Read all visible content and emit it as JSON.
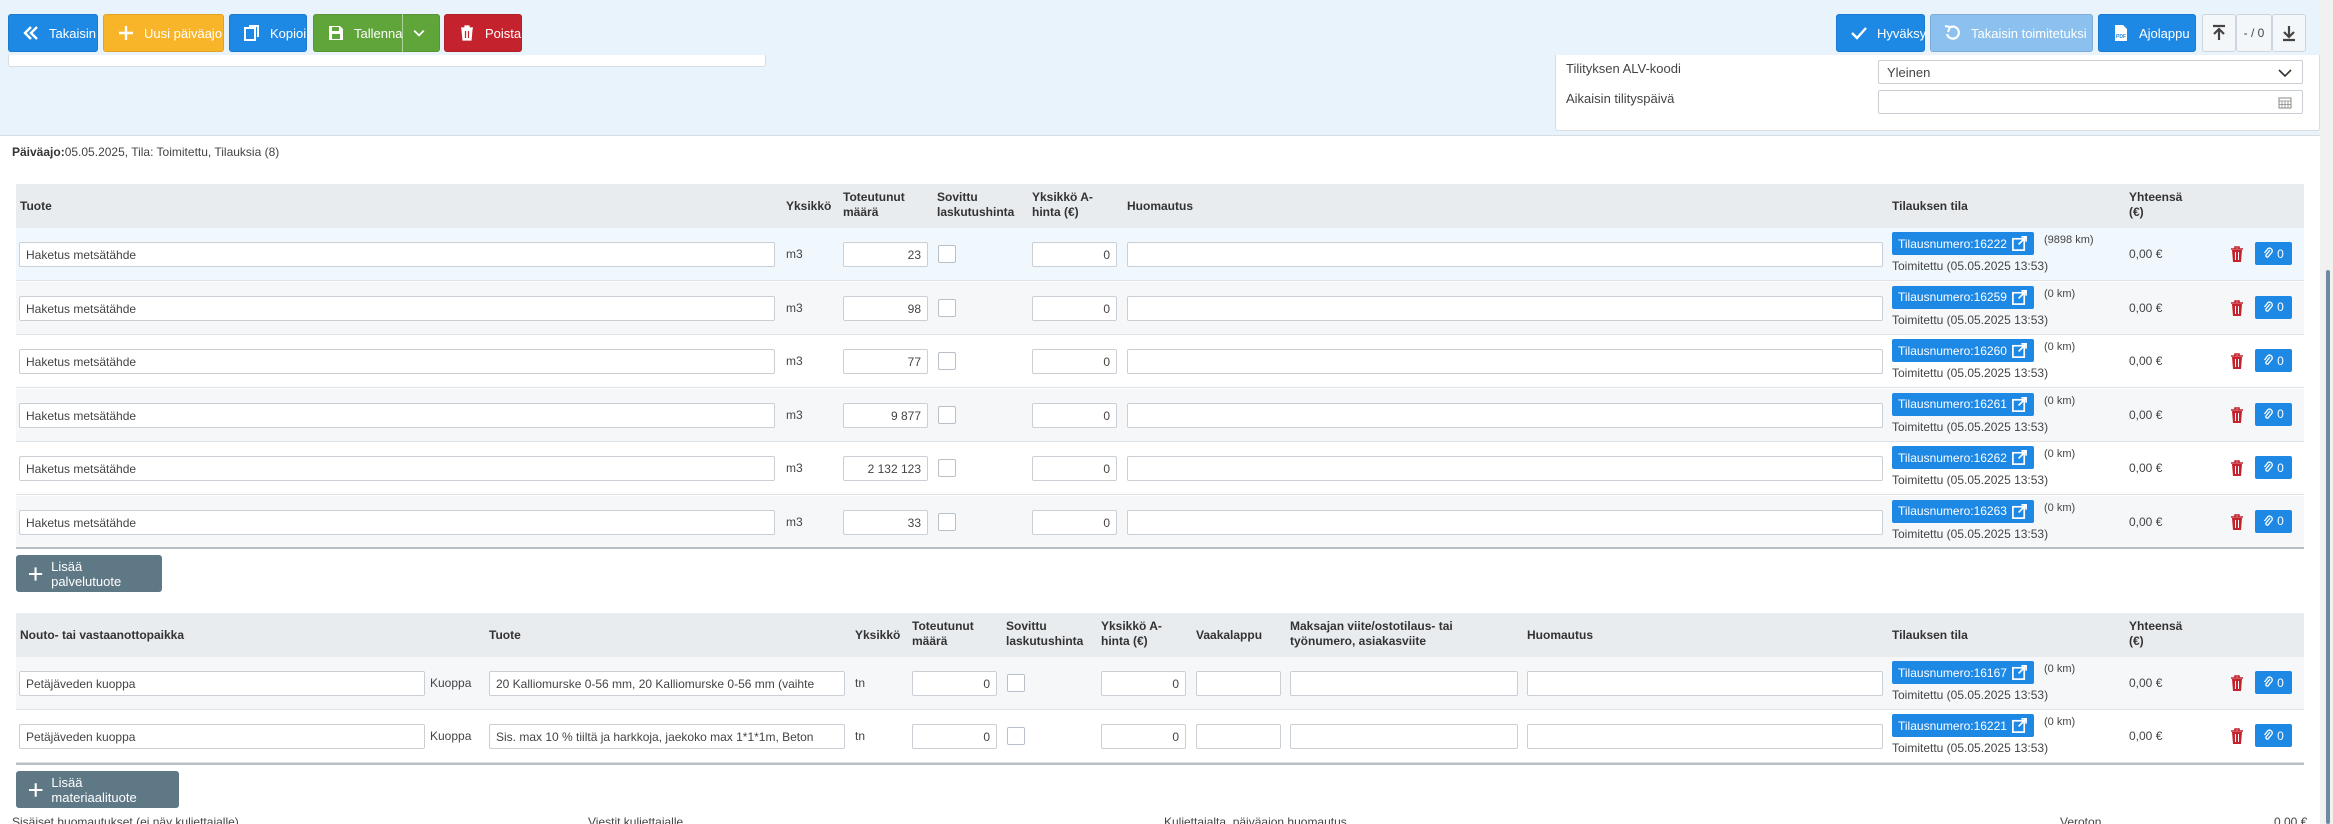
{
  "toolbar": {
    "back": "Takaisin",
    "new_day": "Uusi päiväajo",
    "copy": "Kopioi",
    "save": "Tallenna",
    "delete": "Poista",
    "approve": "Hyväksy",
    "revert": "Takaisin toimitetuksi",
    "trip_pdf": "Ajolappu",
    "counter": "- / 0"
  },
  "settlement": {
    "vat_label": "Tilityksen ALV-koodi",
    "vat_value": "Yleinen",
    "earliest_label": "Aikaisin tilityspäivä",
    "earliest_value": ""
  },
  "day": {
    "title_bold": "Päiväajo:",
    "title_rest": "05.05.2025, Tila: Toimitettu, Tilauksia (8)"
  },
  "services": {
    "headers": {
      "product": "Tuote",
      "unit": "Yksikkö",
      "actual_qty": "Toteutunut määrä",
      "agreed_price": "Sovittu laskutushinta",
      "unit_price": "Yksikkö A-hinta (€)",
      "note": "Huomautus",
      "order_status": "Tilauksen tila",
      "total": "Yhteensä (€)"
    },
    "rows": [
      {
        "product": "Haketus metsätähde",
        "unit": "m3",
        "qty": "23",
        "price": "0",
        "order": "Tilausnumero:16222",
        "distance": "(9898 km)",
        "status": "Toimitettu (05.05.2025 13:53)",
        "total": "0,00 €",
        "attachments": "0"
      },
      {
        "product": "Haketus metsätähde",
        "unit": "m3",
        "qty": "98",
        "price": "0",
        "order": "Tilausnumero:16259",
        "distance": "(0 km)",
        "status": "Toimitettu (05.05.2025 13:53)",
        "total": "0,00 €",
        "attachments": "0"
      },
      {
        "product": "Haketus metsätähde",
        "unit": "m3",
        "qty": "77",
        "price": "0",
        "order": "Tilausnumero:16260",
        "distance": "(0 km)",
        "status": "Toimitettu (05.05.2025 13:53)",
        "total": "0,00 €",
        "attachments": "0"
      },
      {
        "product": "Haketus metsätähde",
        "unit": "m3",
        "qty": "9 877",
        "price": "0",
        "order": "Tilausnumero:16261",
        "distance": "(0 km)",
        "status": "Toimitettu (05.05.2025 13:53)",
        "total": "0,00 €",
        "attachments": "0"
      },
      {
        "product": "Haketus metsätähde",
        "unit": "m3",
        "qty": "2 132 123",
        "price": "0",
        "order": "Tilausnumero:16262",
        "distance": "(0 km)",
        "status": "Toimitettu (05.05.2025 13:53)",
        "total": "0,00 €",
        "attachments": "0"
      },
      {
        "product": "Haketus metsätähde",
        "unit": "m3",
        "qty": "33",
        "price": "0",
        "order": "Tilausnumero:16263",
        "distance": "(0 km)",
        "status": "Toimitettu (05.05.2025 13:53)",
        "total": "0,00 €",
        "attachments": "0"
      }
    ],
    "add_label": "Lisää palvelutuote"
  },
  "materials": {
    "headers": {
      "place": "Nouto- tai vastaanottopaikka",
      "product": "Tuote",
      "unit": "Yksikkö",
      "actual_qty": "Toteutunut määrä",
      "agreed_price": "Sovittu laskutushinta",
      "unit_price": "Yksikkö A-hinta (€)",
      "scale_slip": "Vaakalappu",
      "payer_ref": "Maksajan viite/ostotilaus- tai työnumero, asiakasviite",
      "note": "Huomautus",
      "order_status": "Tilauksen tila",
      "total": "Yhteensä (€)"
    },
    "rows": [
      {
        "place": "Petäjäveden kuoppa",
        "place_type": "Kuoppa",
        "product": "20 Kalliomurske 0-56 mm, 20 Kalliomurske 0-56 mm (vaihte",
        "unit": "tn",
        "qty": "0",
        "price": "0",
        "order": "Tilausnumero:16167",
        "distance": "(0 km)",
        "status": "Toimitettu (05.05.2025 13:53)",
        "total": "0,00 €",
        "attachments": "0"
      },
      {
        "place": "Petäjäveden kuoppa",
        "place_type": "Kuoppa",
        "product": "Sis. max 10 % tiiltä ja harkkoja, jaekoko max 1*1*1m, Beton",
        "unit": "tn",
        "qty": "0",
        "price": "0",
        "order": "Tilausnumero:16221",
        "distance": "(0 km)",
        "status": "Toimitettu (05.05.2025 13:53)",
        "total": "0,00 €",
        "attachments": "0"
      }
    ],
    "add_label": "Lisää materiaalituote"
  },
  "footer": {
    "internal_notes": "Sisäiset huomautukset (ei näy kuljettajalle)",
    "driver_message": "Viestit kuljettajalle",
    "driver_day_note": "Kuljettajalta, päiväajon huomautus",
    "tax_free_label": "Veroton",
    "tax_free_value": "0,00 €"
  }
}
